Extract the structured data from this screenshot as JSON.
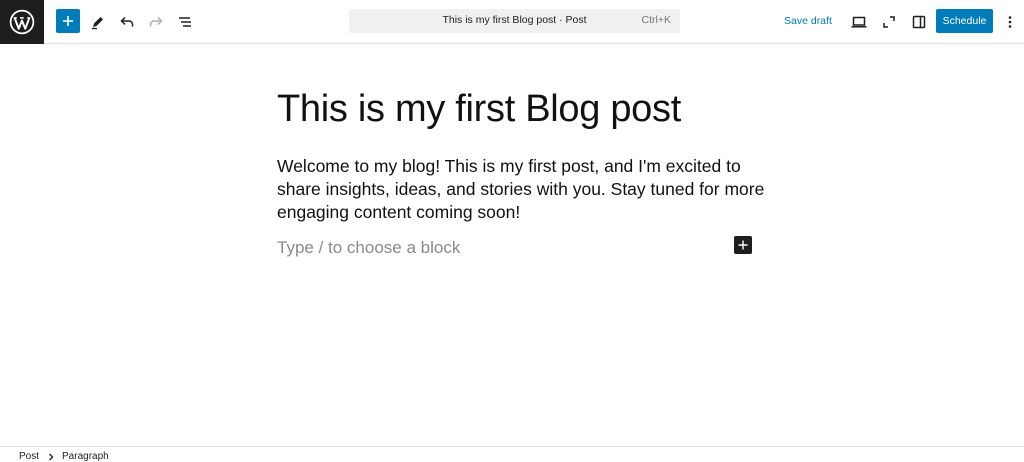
{
  "header": {
    "logo_icon": "wordpress-logo-icon",
    "inserter_icon": "plus-icon",
    "tools_icon": "pencil-icon",
    "undo_icon": "undo-icon",
    "redo_icon": "redo-icon",
    "outline_icon": "list-view-icon",
    "command_bar": {
      "title": "This is my first Blog post · Post",
      "shortcut": "Ctrl+K"
    },
    "save_draft_label": "Save draft",
    "preview_icon": "desktop-preview-icon",
    "fullscreen_icon": "fullscreen-icon",
    "settings_icon": "sidebar-settings-icon",
    "schedule_label": "Schedule",
    "options_icon": "more-vertical-icon"
  },
  "editor": {
    "title": "This is my first Blog post",
    "paragraph": "Welcome to my blog! This is my first post, and I'm excited to share insights, ideas, and stories with you. Stay tuned for more engaging content coming soon!",
    "placeholder": "Type / to choose a block",
    "add_block_icon": "plus-icon"
  },
  "footer": {
    "breadcrumb": [
      "Post",
      "Paragraph"
    ],
    "separator_icon": "chevron-right-icon"
  },
  "colors": {
    "accent": "#007cba",
    "dark": "#1e1e1e",
    "command_bar_bg": "#f0f0f0",
    "placeholder": "#8a8a8a"
  }
}
